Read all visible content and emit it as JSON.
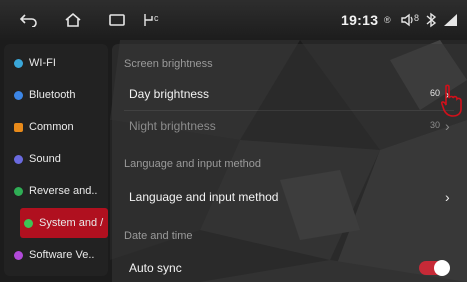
{
  "status_bar": {
    "time": "19:13",
    "usb_badge": "c",
    "time_mark": "®",
    "signal_badge": "8",
    "icons": [
      "back-icon",
      "home-icon",
      "recent-apps-icon",
      "usb-icon",
      "location-icon",
      "volume-icon",
      "bluetooth-icon",
      "signal-icon"
    ]
  },
  "sidebar": {
    "items": [
      {
        "label": "WI-FI",
        "color": "#3aa7d9",
        "active": false
      },
      {
        "label": "Bluetooth",
        "color": "#3c86e6",
        "active": false
      },
      {
        "label": "Common",
        "color": "#e88a1a",
        "active": false
      },
      {
        "label": "Sound",
        "color": "#6a6adf",
        "active": false
      },
      {
        "label": "Reverse and..",
        "color": "#2fae55",
        "active": false
      },
      {
        "label": "System and /",
        "color": "#3ec356",
        "active": true
      },
      {
        "label": "Software Ve..",
        "color": "#b14ad9",
        "active": false
      }
    ]
  },
  "main": {
    "sections": {
      "screen_brightness": "Screen brightness",
      "language": "Language and input method",
      "date_time": "Date and time"
    },
    "rows": {
      "day_brightness": {
        "label": "Day brightness",
        "value": "60"
      },
      "night_brightness": {
        "label": "Night brightness",
        "value": "30"
      },
      "language_input": {
        "label": "Language and input method"
      },
      "auto_sync": {
        "label": "Auto sync",
        "enabled": true
      }
    }
  },
  "colors": {
    "accent": "#b0101f",
    "toggle_on": "#c62a37",
    "hand_annotation": "#d0101a"
  }
}
